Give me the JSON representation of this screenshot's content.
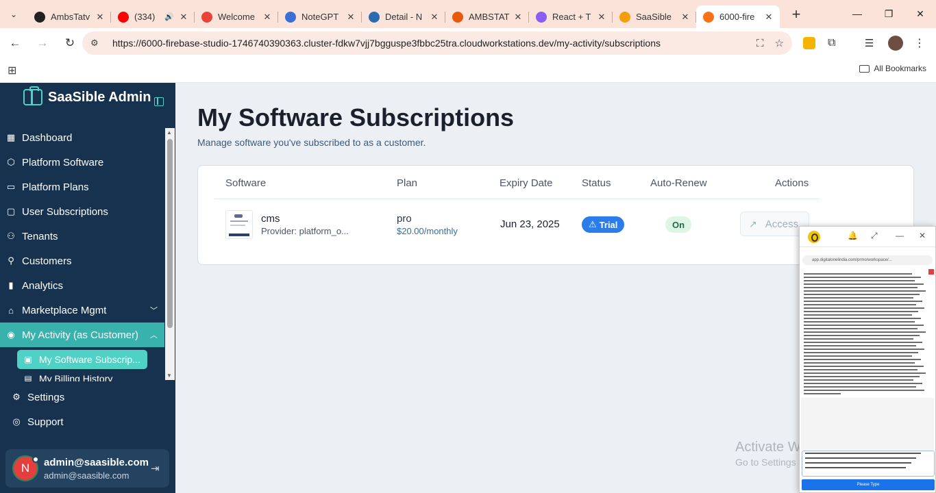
{
  "browser": {
    "tabs": [
      {
        "title": "AmbsTatv",
        "favicon_color": "#222222",
        "active": false,
        "audio": false
      },
      {
        "title": "(334)",
        "favicon_color": "#ff0000",
        "active": false,
        "audio": true
      },
      {
        "title": "Welcome",
        "favicon_color": "#ea4335",
        "active": false,
        "audio": false
      },
      {
        "title": "NoteGPT",
        "favicon_color": "#3b6fd6",
        "active": false,
        "audio": false
      },
      {
        "title": "Detail - N",
        "favicon_color": "#2b6cb0",
        "active": false,
        "audio": false
      },
      {
        "title": "AMBSTAT",
        "favicon_color": "#e8590c",
        "active": false,
        "audio": false
      },
      {
        "title": "React + T",
        "favicon_color": "#8b5cf6",
        "active": false,
        "audio": false
      },
      {
        "title": "SaaSible",
        "favicon_color": "#f59e0b",
        "active": false,
        "audio": false
      },
      {
        "title": "6000-fire",
        "favicon_color": "#f97316",
        "active": true,
        "audio": false
      }
    ],
    "url": "https://6000-firebase-studio-1746740390363.cluster-fdkw7vjj7bgguspe3fbbc25tra.cloudworkstations.dev/my-activity/subscriptions",
    "bookmarks_label": "All Bookmarks"
  },
  "sidebar": {
    "brand": "SaaSible Admin",
    "items": [
      {
        "label": "Dashboard",
        "icon": "dashboard-icon",
        "glyph": "▦"
      },
      {
        "label": "Platform Software",
        "icon": "package-icon",
        "glyph": "⬡"
      },
      {
        "label": "Platform Plans",
        "icon": "plans-icon",
        "glyph": "▭"
      },
      {
        "label": "User Subscriptions",
        "icon": "subscriptions-icon",
        "glyph": "▢"
      },
      {
        "label": "Tenants",
        "icon": "users-icon",
        "glyph": "⚇"
      },
      {
        "label": "Customers",
        "icon": "user-icon",
        "glyph": "⚲"
      },
      {
        "label": "Analytics",
        "icon": "bar-chart-icon",
        "glyph": "▮"
      },
      {
        "label": "Marketplace Mgmt",
        "icon": "store-icon",
        "glyph": "⌂"
      }
    ],
    "my_activity": {
      "label": "My Activity (as Customer)",
      "sub_items": [
        {
          "label": "My Software Subscrip...",
          "active": true
        },
        {
          "label": "My Billing History",
          "active": false
        }
      ]
    },
    "settings_label": "Settings",
    "support_label": "Support",
    "user": {
      "initial": "N",
      "name": "admin@saasible.com",
      "email": "admin@saasible.com"
    }
  },
  "main": {
    "title": "My Software Subscriptions",
    "subtitle": "Manage software you've subscribed to as a customer.",
    "columns": {
      "software": "Software",
      "plan": "Plan",
      "expiry": "Expiry Date",
      "status": "Status",
      "auto_renew": "Auto-Renew",
      "actions": "Actions"
    },
    "rows": [
      {
        "software": "cms",
        "provider": "Provider: platform_o...",
        "plan": "pro",
        "price": "$20.00/monthly",
        "expiry": "Jun 23, 2025",
        "status": "Trial",
        "auto_renew": "On",
        "action": "Access"
      }
    ]
  },
  "watermark": {
    "line1": "Activate Windows",
    "line2": "Go to Settings"
  },
  "floating_window": {
    "url": "app.digitalonelindia.com/prmo/workspace/...",
    "button_label": "Please Type"
  }
}
